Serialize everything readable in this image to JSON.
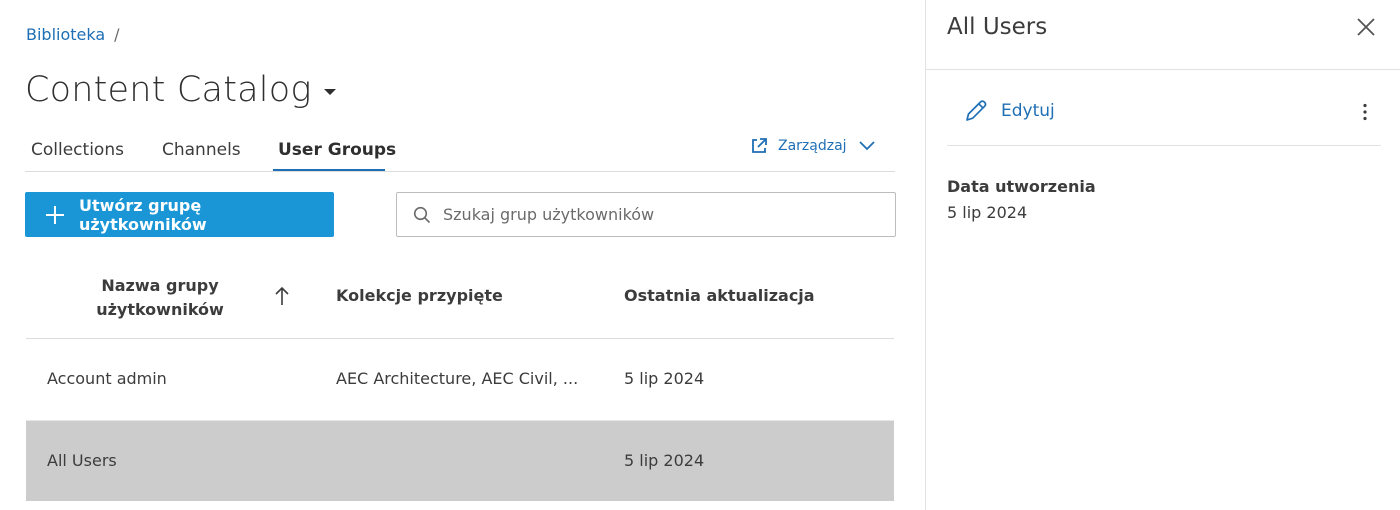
{
  "breadcrumb": {
    "link": "Biblioteka",
    "separator": "/"
  },
  "header": {
    "title": "Content Catalog"
  },
  "tabs": [
    {
      "label": "Collections",
      "active": false
    },
    {
      "label": "Channels",
      "active": false
    },
    {
      "label": "User Groups",
      "active": true
    }
  ],
  "manage": {
    "label": "Zarządzaj"
  },
  "toolbar": {
    "create_label": "Utwórz grupę użytkowników",
    "search_placeholder": "Szukaj grup użytkowników",
    "search_value": ""
  },
  "table": {
    "columns": {
      "name": "Nazwa grupy użytkowników",
      "collections": "Kolekcje przypięte",
      "updated": "Ostatnia aktualizacja"
    },
    "sort": "ascending",
    "rows": [
      {
        "name": "Account admin",
        "collections": "AEC Architecture, AEC Civil, ...",
        "updated": "5 lip 2024",
        "selected": false
      },
      {
        "name": "All Users",
        "collections": "",
        "updated": "5 lip 2024",
        "selected": true
      }
    ]
  },
  "panel": {
    "title": "All Users",
    "edit_label": "Edytuj",
    "created_label": "Data utworzenia",
    "created_value": "5 lip 2024"
  },
  "colors": {
    "accent": "#1e6fb5",
    "primary_button": "#1a96d6",
    "selected_row": "#cccccc"
  },
  "icons": {
    "manage": "external-link-icon",
    "manage_chevron": "chevron-down-icon",
    "create": "plus-icon",
    "search": "search-icon",
    "sort": "arrow-up-icon",
    "close": "close-icon",
    "edit": "pencil-icon",
    "more": "more-vertical-icon"
  }
}
